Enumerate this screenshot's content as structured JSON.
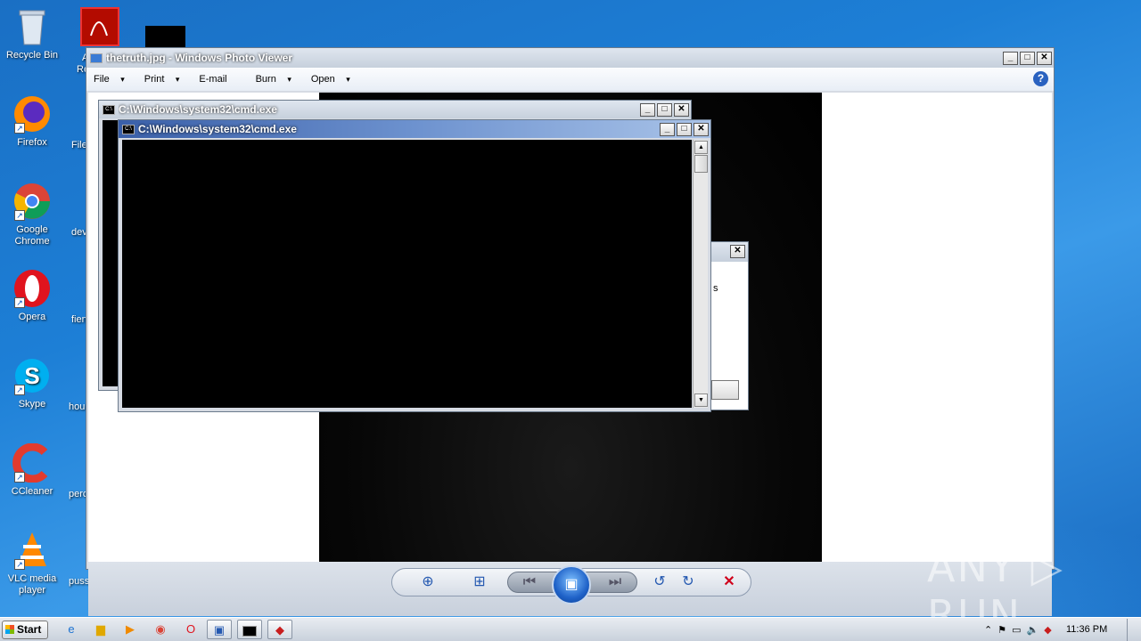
{
  "desktop": {
    "icons": [
      {
        "label": "Recycle Bin",
        "icon": "recycle-bin-icon"
      },
      {
        "label": "Firefox",
        "icon": "firefox-icon"
      },
      {
        "label": "Google Chrome",
        "icon": "chrome-icon"
      },
      {
        "label": "Opera",
        "icon": "opera-icon"
      },
      {
        "label": "Skype",
        "icon": "skype-icon"
      },
      {
        "label": "CCleaner",
        "icon": "ccleaner-icon"
      },
      {
        "label": "VLC media player",
        "icon": "vlc-icon"
      }
    ],
    "partial_labels": [
      "A",
      "Re",
      "File",
      "dev",
      "fien",
      "hou",
      "perc"
    ],
    "file_label": "pussynon.png"
  },
  "photo_viewer": {
    "title": "thetruth.jpg - Windows Photo Viewer",
    "menu": [
      "File",
      "Print",
      "E-mail",
      "Burn",
      "Open"
    ],
    "help": "?"
  },
  "cmd_back": {
    "title": "C:\\Windows\\system32\\cmd.exe"
  },
  "cmd_front": {
    "title": "C:\\Windows\\system32\\cmd.exe"
  },
  "dialog": {
    "partial_text": "s"
  },
  "window_buttons": {
    "minimize": "_",
    "maximize": "□",
    "close": "✕"
  },
  "taskbar": {
    "start_label": "Start",
    "clock": "11:36 PM"
  },
  "watermark": "ANY ▷ RUN",
  "colors": {
    "accent": "#2458b0",
    "close_red": "#d0021b"
  }
}
